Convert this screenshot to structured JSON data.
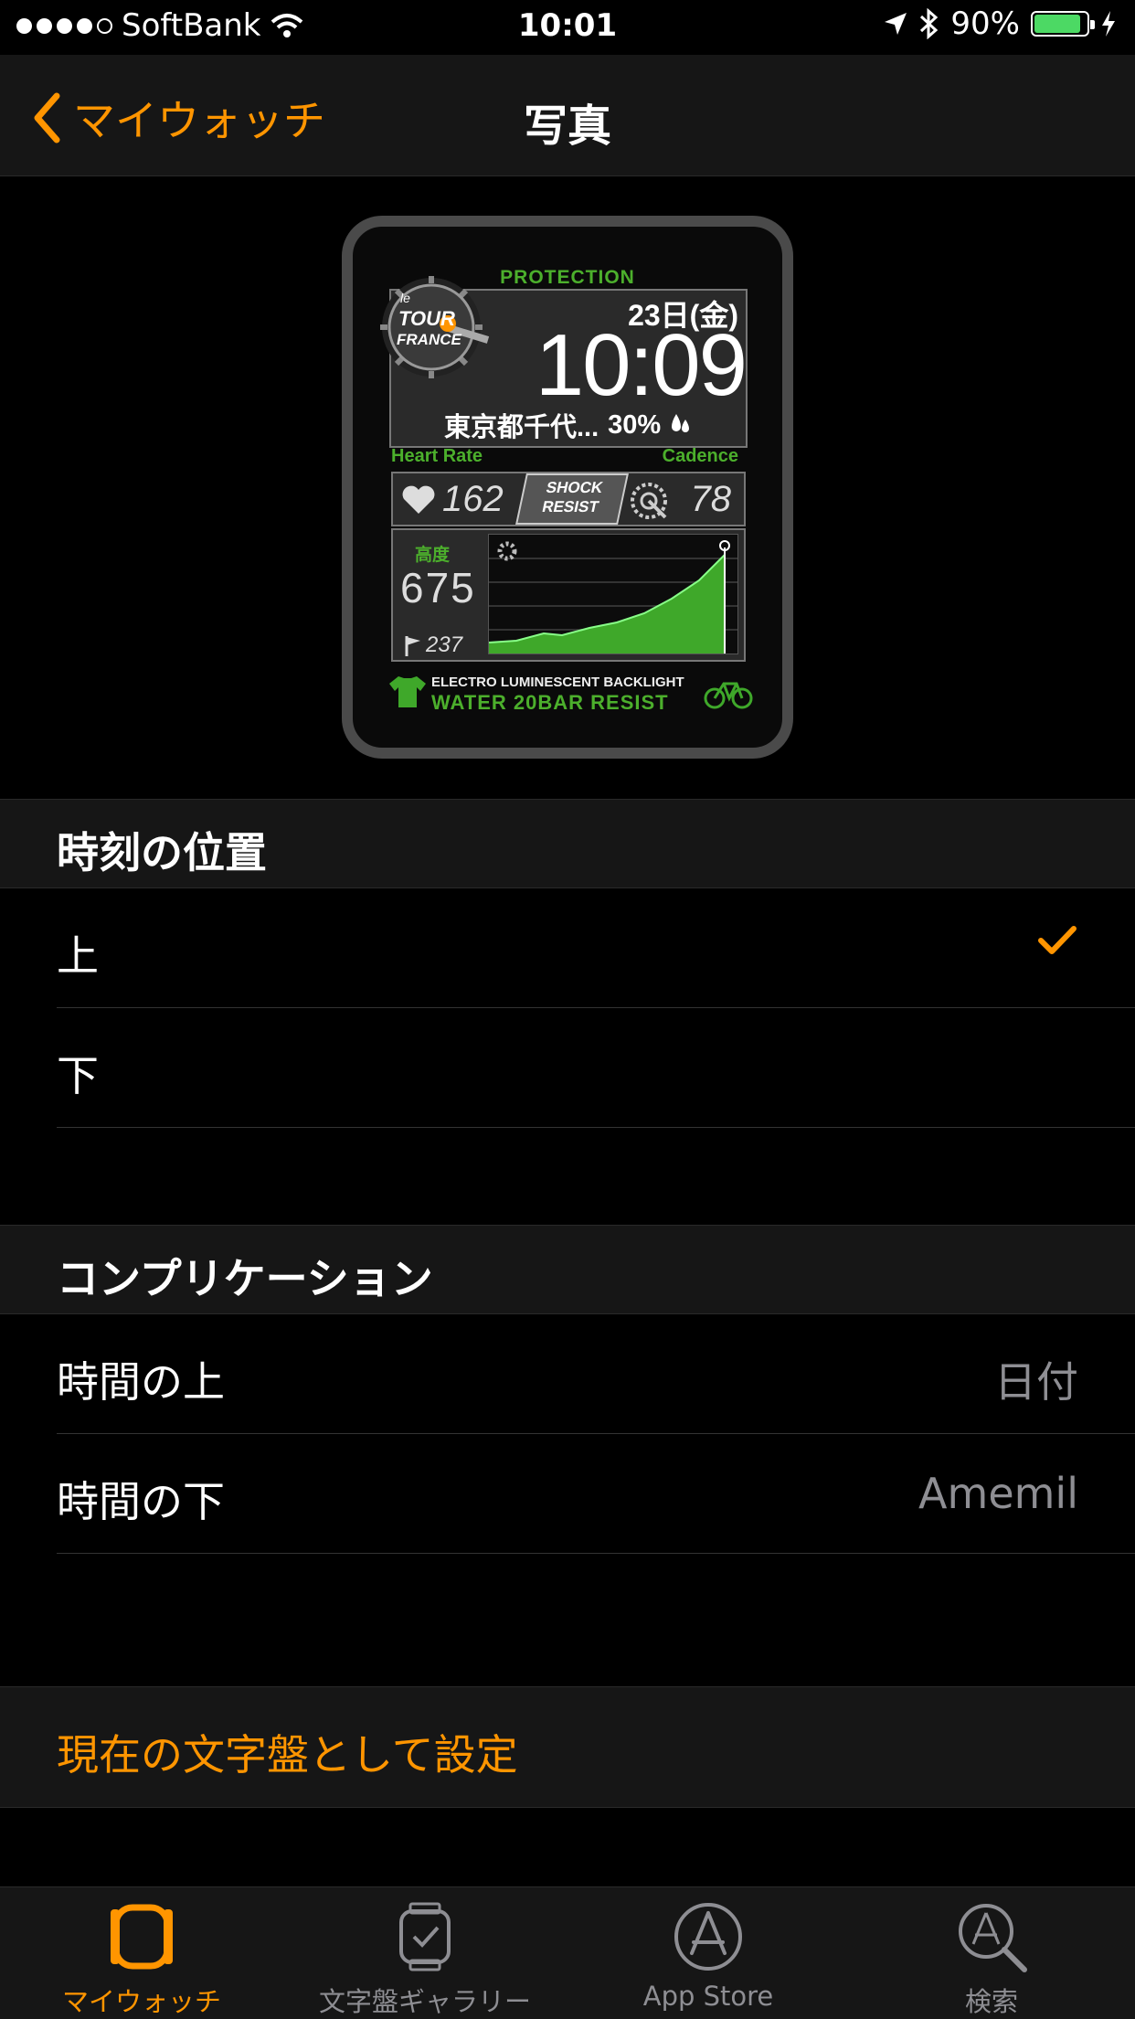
{
  "status": {
    "carrier": "SoftBank",
    "time": "10:01",
    "battery": "90%",
    "battery_level": 0.9
  },
  "nav": {
    "back_label": "マイウォッチ",
    "title": "写真"
  },
  "watch_face": {
    "protection": "PROTECTION",
    "date": "23日(金)",
    "time": "10:09",
    "location": "東京都千代...",
    "humidity": "30%",
    "heart_rate_label": "Heart Rate",
    "cadence_label": "Cadence",
    "heart_rate": "162",
    "shock_line1": "SHOCK",
    "shock_line2": "RESIST",
    "cadence": "78",
    "altitude_label": "高度",
    "altitude": "675",
    "flag_value": "237",
    "backlight": "ELECTRO LUMINESCENT BACKLIGHT",
    "water": "WATER 20BAR RESIST",
    "logo_line1": "le",
    "logo_line2": "TOUR",
    "logo_line3": "FRANCE"
  },
  "time_position": {
    "header": "時刻の位置",
    "options": [
      {
        "label": "上",
        "selected": true
      },
      {
        "label": "下",
        "selected": false
      }
    ]
  },
  "complications": {
    "header": "コンプリケーション",
    "rows": [
      {
        "label": "時間の上",
        "value": "日付"
      },
      {
        "label": "時間の下",
        "value": "Amemil"
      }
    ]
  },
  "action": {
    "label": "現在の文字盤として設定"
  },
  "tabs": [
    {
      "label": "マイウォッチ",
      "icon": "watch-icon",
      "active": true
    },
    {
      "label": "文字盤ギャラリー",
      "icon": "watch-face-gallery-icon",
      "active": false
    },
    {
      "label": "App Store",
      "icon": "app-store-icon",
      "active": false
    },
    {
      "label": "検索",
      "icon": "search-icon",
      "active": false
    }
  ],
  "colors": {
    "accent": "#ff9500",
    "watch_green": "#4caf2c",
    "battery_green": "#4cd964"
  }
}
